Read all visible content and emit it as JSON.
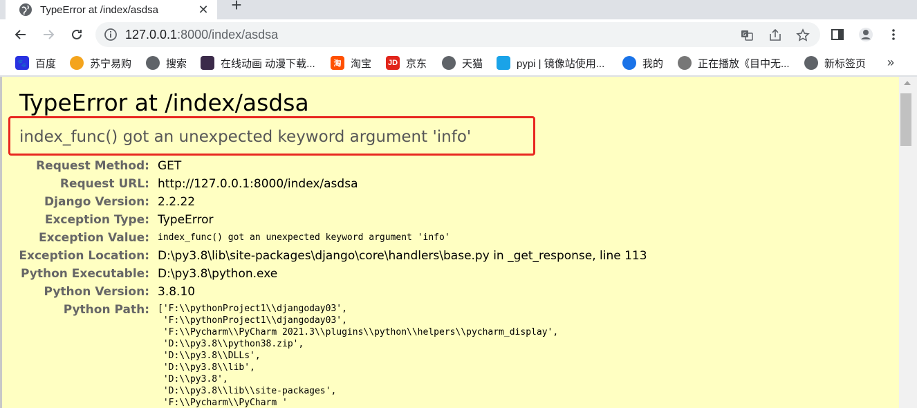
{
  "browser": {
    "tab_title": "TypeError at /index/asdsa",
    "tab_close": "✕",
    "new_tab": "+",
    "url_host": "127.0.0.1",
    "url_rest": ":8000/index/asdsa",
    "bookmarks": [
      {
        "label": "百度",
        "icon": "baidu-icon",
        "color": "#2932e1"
      },
      {
        "label": "苏宁易购",
        "icon": "suning-icon",
        "color": "#f4a41d"
      },
      {
        "label": "搜索",
        "icon": "globe-icon",
        "color": "#5f6368"
      },
      {
        "label": "在线动画 动漫下载...",
        "icon": "anime-icon",
        "color": "#3b2a4a"
      },
      {
        "label": "淘宝",
        "icon": "taobao-icon",
        "color": "#ff5000"
      },
      {
        "label": "京东",
        "icon": "jd-icon",
        "color": "#e1251b"
      },
      {
        "label": "天猫",
        "icon": "globe-icon",
        "color": "#5f6368"
      },
      {
        "label": "pypi | 镜像站使用...",
        "icon": "pypi-icon",
        "color": "#1aa3e8"
      },
      {
        "label": "我的",
        "icon": "mine-icon",
        "color": "#1a73e8"
      },
      {
        "label": "正在播放《目中无...",
        "icon": "film-icon",
        "color": "#777"
      },
      {
        "label": "新标签页",
        "icon": "globe-icon",
        "color": "#5f6368"
      }
    ],
    "bookmarks_more": "»"
  },
  "error": {
    "title": "TypeError at /index/asdsa",
    "message": "index_func() got an unexpected keyword argument 'info'"
  },
  "meta": {
    "request_method": {
      "label": "Request Method:",
      "value": "GET"
    },
    "request_url": {
      "label": "Request URL:",
      "value": "http://127.0.0.1:8000/index/asdsa"
    },
    "django_version": {
      "label": "Django Version:",
      "value": "2.2.22"
    },
    "exception_type": {
      "label": "Exception Type:",
      "value": "TypeError"
    },
    "exception_value": {
      "label": "Exception Value:",
      "value": "index_func() got an unexpected keyword argument 'info'"
    },
    "exception_location": {
      "label": "Exception Location:",
      "value": "D:\\py3.8\\lib\\site-packages\\django\\core\\handlers\\base.py in _get_response, line 113"
    },
    "python_executable": {
      "label": "Python Executable:",
      "value": "D:\\py3.8\\python.exe"
    },
    "python_version": {
      "label": "Python Version:",
      "value": "3.8.10"
    },
    "python_path": {
      "label": "Python Path:",
      "value": "['F:\\\\pythonProject1\\\\djangoday03',\n 'F:\\\\pythonProject1\\\\djangoday03',\n 'F:\\\\Pycharm\\\\PyCharm 2021.3\\\\plugins\\\\python\\\\helpers\\\\pycharm_display',\n 'D:\\\\py3.8\\\\python38.zip',\n 'D:\\\\py3.8\\\\DLLs',\n 'D:\\\\py3.8\\\\lib',\n 'D:\\\\py3.8',\n 'D:\\\\py3.8\\\\lib\\\\site-packages',\n 'F:\\\\Pycharm\\\\PyCharm '"
    }
  }
}
